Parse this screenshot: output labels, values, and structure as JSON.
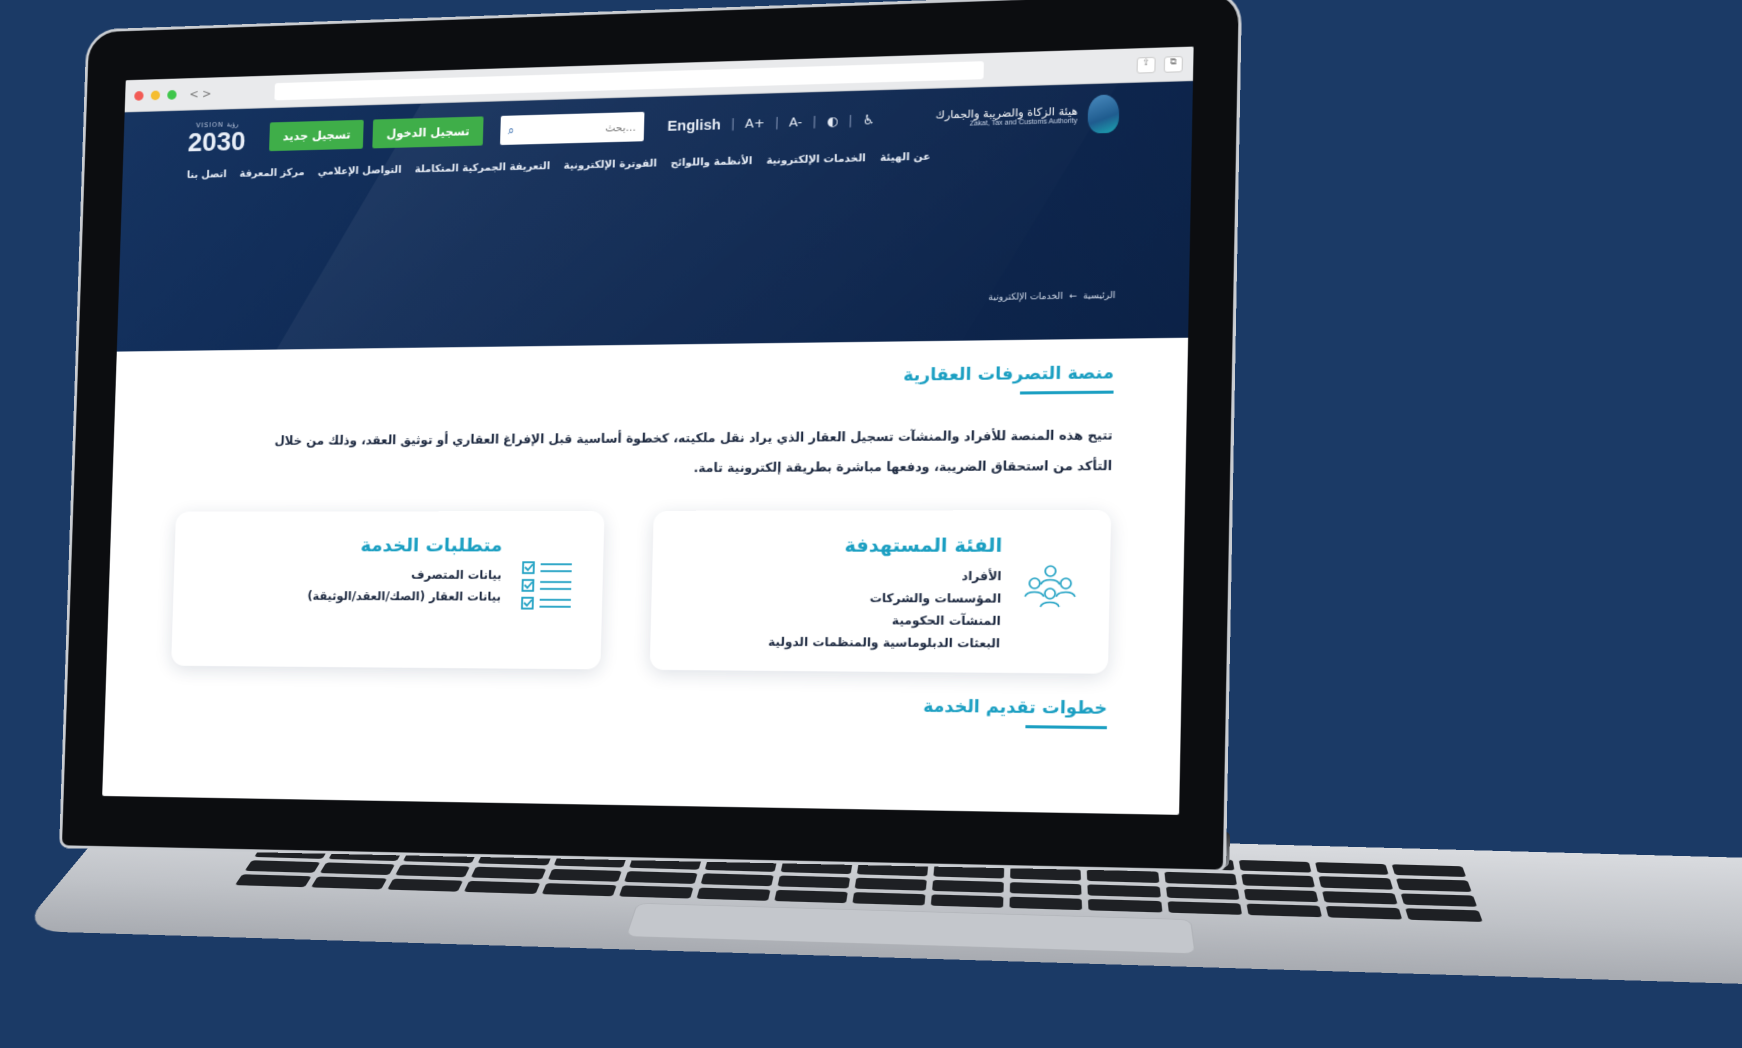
{
  "browser": {
    "nav_arrows": "< >"
  },
  "header": {
    "vision_small": "VISION رؤية",
    "vision_year": "2030",
    "register_button": "تسجيل جديد",
    "login_button": "تسجيل الدخول",
    "search_placeholder": "بحث...",
    "language": "English",
    "font_increase": "A+",
    "font_decrease": "A-",
    "brand_ar": "هيئة الزكاة والضريبة والجمارك",
    "brand_en": "Zakat, Tax and Customs Authority"
  },
  "nav": {
    "items": [
      "عن الهيئة",
      "الخدمات الإلكترونية",
      "الأنظمة واللوائح",
      "الفوترة الإلكترونية",
      "التعريفة الجمركية المتكاملة",
      "التواصل الإعلامي",
      "مركز المعرفة",
      "اتصل بنا"
    ]
  },
  "breadcrumb": {
    "home": "الرئيسية",
    "arrow": "←",
    "current": "الخدمات الإلكترونية"
  },
  "main": {
    "title": "منصة التصرفات العقارية",
    "intro": "تتيح هذه المنصة للأفراد والمنشآت تسجيل العقار الذي يراد نقل ملكيته، كخطوة أساسية قبل الإفراغ العقاري أو توثيق العقد، وذلك من خلال التأكد من استحقاق الضريبة، ودفعها مباشرة بطريقة إلكترونية تامة.",
    "target_card": {
      "title": "الفئة المستهدفة",
      "items": [
        "الأفراد",
        "المؤسسات والشركات",
        "المنشآت الحكومية",
        "البعثات الدبلوماسية والمنظمات الدولية"
      ]
    },
    "requirements_card": {
      "title": "متطلبات الخدمة",
      "items": [
        "بيانات المتصرف",
        "بيانات العقار (الصك/العقد/الوثيقة)"
      ]
    },
    "steps_title": "خطوات تقديم الخدمة"
  },
  "colors": {
    "page_bg": "#1b3a66",
    "header_bg": "#0f2a55",
    "accent": "#1b9fc2",
    "green": "#3fae49"
  }
}
